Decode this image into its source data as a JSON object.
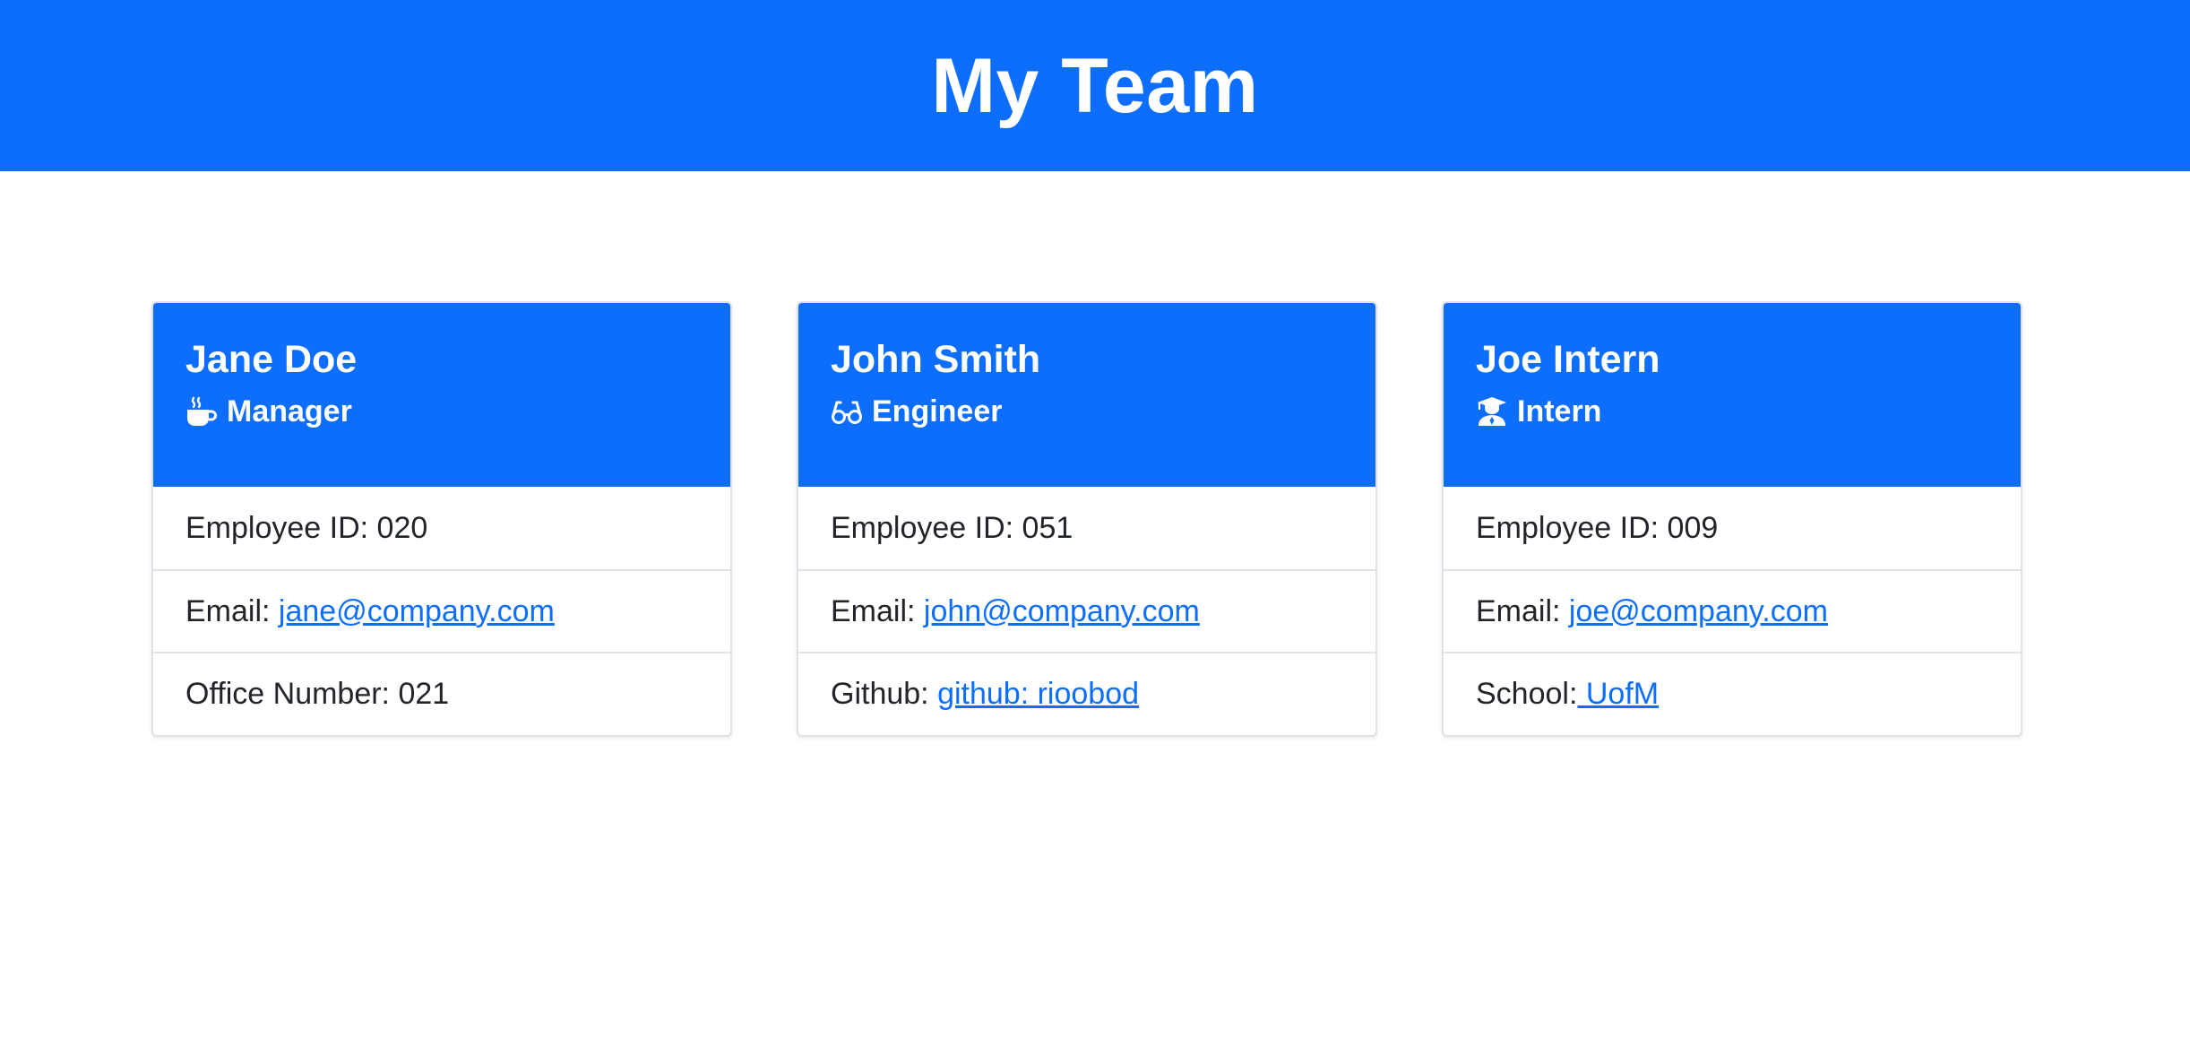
{
  "header": {
    "title": "My Team"
  },
  "employees": [
    {
      "name": "Jane Doe",
      "role": "Manager",
      "role_icon": "coffee-mug-icon",
      "id_label": "Employee ID: 020",
      "email_label": "Email: ",
      "email": "jane@company.com",
      "extra_label": "Office Number: 021",
      "extra_link": ""
    },
    {
      "name": "John Smith",
      "role": "Engineer",
      "role_icon": "glasses-icon",
      "id_label": "Employee ID: 051",
      "email_label": "Email: ",
      "email": "john@company.com",
      "extra_label": "Github: ",
      "extra_link": "github: rioobod"
    },
    {
      "name": "Joe Intern",
      "role": "Intern",
      "role_icon": "graduate-icon",
      "id_label": "Employee ID: 009",
      "email_label": "Email: ",
      "email": "joe@company.com",
      "extra_label": "School:",
      "extra_link": " UofM"
    }
  ],
  "colors": {
    "primary": "#0d6efd",
    "text": "#212529",
    "border": "#dfe2e6"
  }
}
